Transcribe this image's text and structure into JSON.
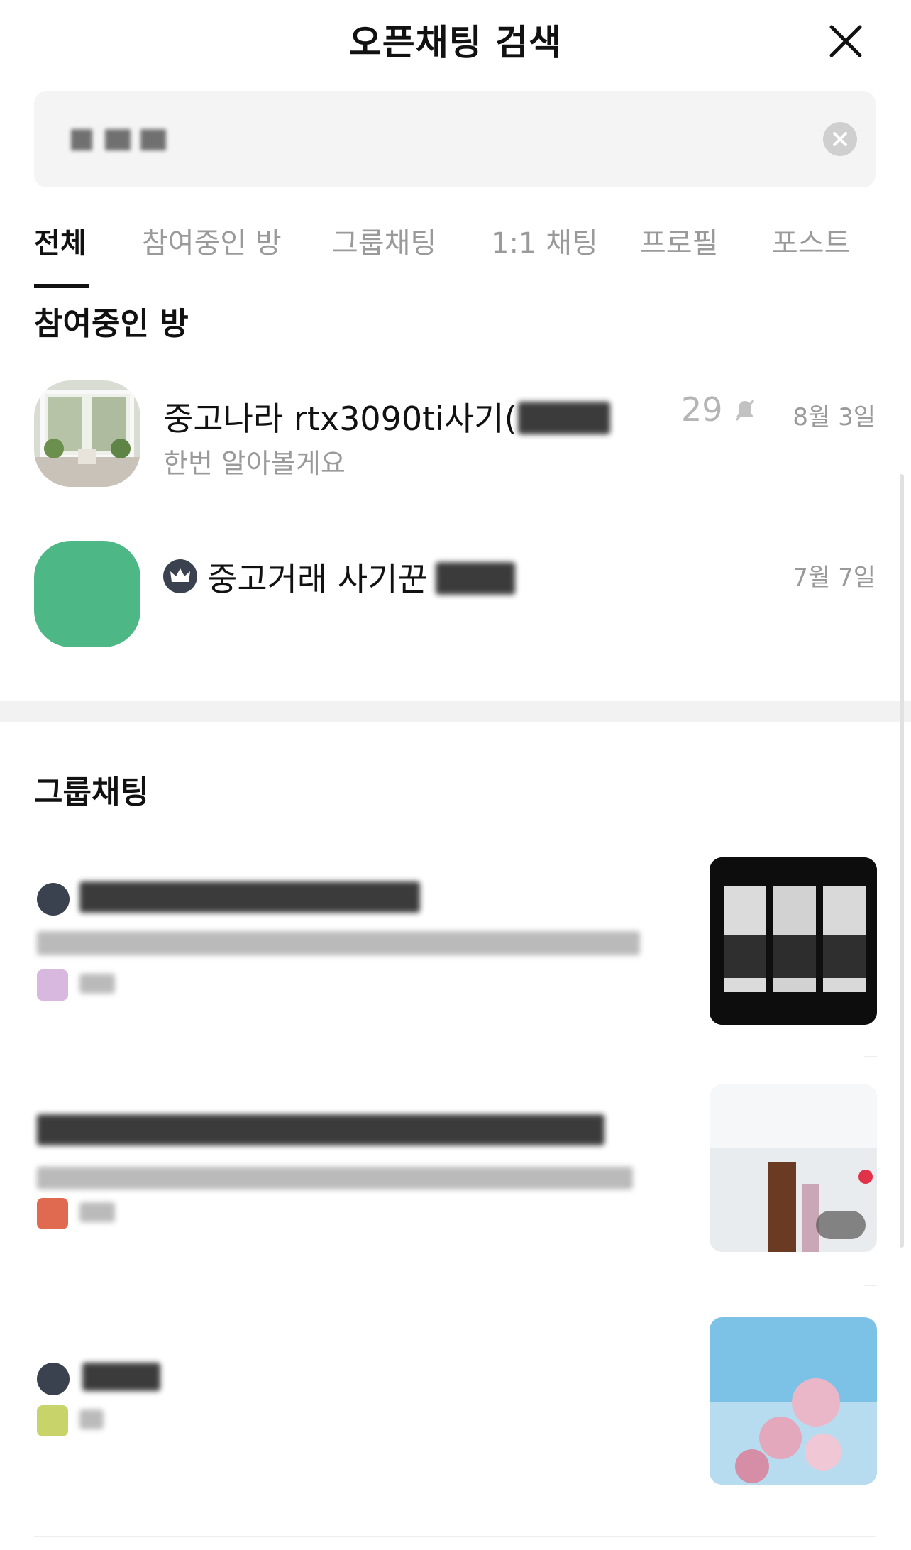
{
  "header": {
    "title": "오픈채팅 검색",
    "close_icon": "close-icon"
  },
  "search": {
    "value": "",
    "clear_icon": "clear-icon"
  },
  "tabs": [
    {
      "label": "전체",
      "active": true
    },
    {
      "label": "참여중인 방",
      "active": false
    },
    {
      "label": "그룹채팅",
      "active": false
    },
    {
      "label": "1:1 채팅",
      "active": false
    },
    {
      "label": "프로필",
      "active": false
    },
    {
      "label": "포스트",
      "active": false
    }
  ],
  "joined": {
    "section_title": "참여중인 방",
    "rooms": [
      {
        "name": "중고나라 rtx3090ti사기(",
        "subtitle": "한번 알아볼게요",
        "count": "29",
        "date": "8월 3일",
        "muted": true
      },
      {
        "name": "중고거래 사기꾼",
        "subtitle": "",
        "count": "",
        "date": "7월 7일",
        "crown": true
      }
    ]
  },
  "group": {
    "section_title": "그룹채팅"
  },
  "colors": {
    "accent": "#4db885",
    "text": "#111111",
    "muted": "#9a9a9a",
    "background": "#ffffff"
  }
}
